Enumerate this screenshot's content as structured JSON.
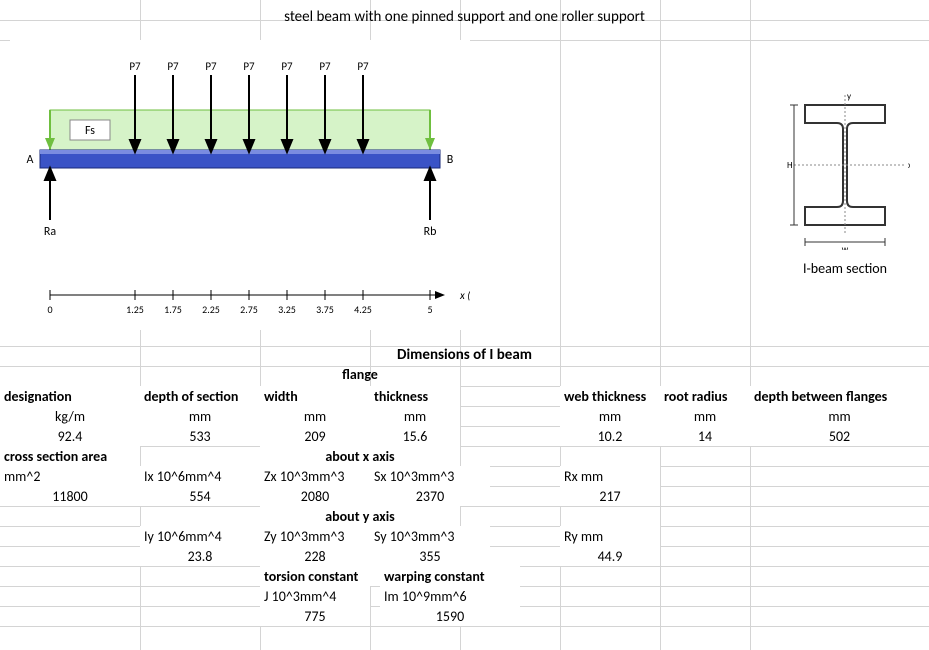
{
  "title": "steel beam with one pinned support and one roller support",
  "beam_diagram": {
    "load_labels": [
      "P7",
      "P7",
      "P7",
      "P7",
      "P7",
      "P7",
      "P7"
    ],
    "fs_label": "Fs",
    "end_A": "A",
    "end_B": "B",
    "reaction_A": "Ra",
    "reaction_B": "Rb",
    "axis_label": "x (m)",
    "axis_ticks": [
      "0",
      "1.25",
      "1.75",
      "2.25",
      "2.75",
      "3.25",
      "3.75",
      "4.25",
      "5"
    ]
  },
  "ibeam_caption": "I-beam section",
  "section_heading": "Dimensions of I beam",
  "flange_heading": "flange",
  "headers": {
    "designation": "designation",
    "depth_of_section": "depth of section",
    "width": "width",
    "thickness": "thickness",
    "web_thickness": "web thickness",
    "root_radius": "root radius",
    "depth_between_flanges": "depth between flanges",
    "cross_section_area": "cross section area",
    "about_x": "about x axis",
    "about_y": "about y axis",
    "torsion_constant": "torsion constant",
    "warping_constant": "warping constant"
  },
  "units": {
    "designation": "kg/m",
    "depth_of_section": "mm",
    "width": "mm",
    "thickness": "mm",
    "web_thickness": "mm",
    "root_radius": "mm",
    "depth_between_flanges": "mm",
    "cross_section_area": "mm^2",
    "Ix": "Ix 10^6mm^4",
    "Zx": "Zx 10^3mm^3",
    "Sx": "Sx  10^3mm^3",
    "Rx": "Rx mm",
    "Iy": "Iy 10^6mm^4",
    "Zy": "Zy 10^3mm^3",
    "Sy": "Sy 10^3mm^3",
    "Ry": "Ry mm",
    "J": "J 10^3mm^4",
    "Im": "Im 10^9mm^6"
  },
  "values": {
    "designation": "92.4",
    "depth_of_section": "533",
    "width": "209",
    "thickness": "15.6",
    "web_thickness": "10.2",
    "root_radius": "14",
    "depth_between_flanges": "502",
    "cross_section_area": "11800",
    "Ix": "554",
    "Zx": "2080",
    "Sx": "2370",
    "Rx": "217",
    "Iy": "23.8",
    "Zy": "228",
    "Sy": "355",
    "Ry": "44.9",
    "J": "775",
    "Im": "1590"
  },
  "chart_data": {
    "type": "diagram",
    "description": "Simply supported beam A-B length 5 m with pinned support at A (reaction Ra) and roller support at B (reaction Rb). Seven concentrated loads P7 applied downward at x = 1.25, 1.75, 2.25, 2.75, 3.25, 3.75, 4.25 m. Uniform/axial load Fs shown along span as green arrows pointing inward/down.",
    "span_m": 5,
    "load_positions_m": [
      1.25,
      1.75,
      2.25,
      2.75,
      3.25,
      3.75,
      4.25
    ],
    "load_name": "P7",
    "distributed_load": "Fs",
    "support_A": "pinned",
    "support_B": "roller"
  }
}
